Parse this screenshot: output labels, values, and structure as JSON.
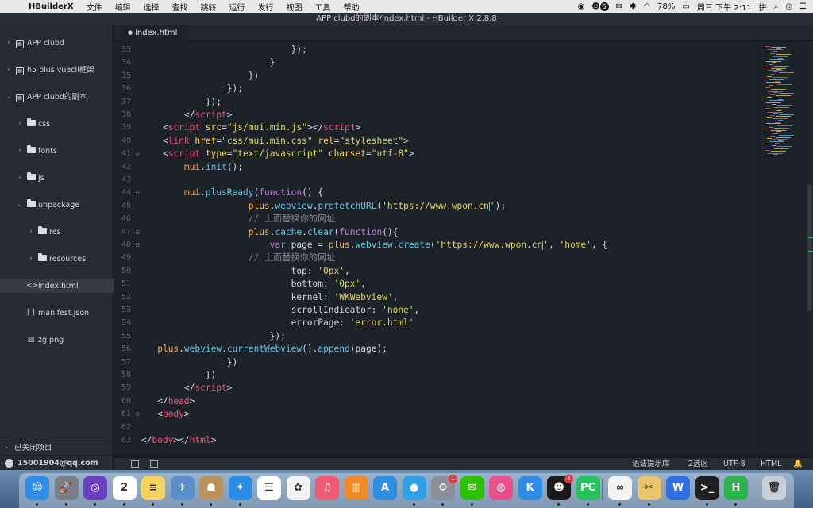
{
  "menubar": {
    "apple_glyph": "",
    "app_name": "HBuilderX",
    "items": [
      "文件",
      "编辑",
      "选择",
      "查找",
      "跳转",
      "运行",
      "发行",
      "视图",
      "工具",
      "帮助"
    ],
    "tray": {
      "notification_count": "5",
      "battery": "78%",
      "datetime": "周三 下午 2:11",
      "input_method": "拼"
    }
  },
  "window": {
    "title": "APP clubd的副本/index.html - HBuilder X 2.8.8"
  },
  "sidebar": {
    "tree": [
      {
        "label": "APP clubd",
        "level": 0,
        "type": "project",
        "expanded": false
      },
      {
        "label": "h5 plus vuecli框架",
        "level": 0,
        "type": "project",
        "expanded": false
      },
      {
        "label": "APP clubd的副本",
        "level": 0,
        "type": "project",
        "expanded": true
      },
      {
        "label": "css",
        "level": 1,
        "type": "folder",
        "expanded": false
      },
      {
        "label": "fonts",
        "level": 1,
        "type": "folder",
        "expanded": false
      },
      {
        "label": "js",
        "level": 1,
        "type": "folder",
        "expanded": false
      },
      {
        "label": "unpackage",
        "level": 1,
        "type": "folder",
        "expanded": true
      },
      {
        "label": "res",
        "level": 2,
        "type": "folder",
        "expanded": false
      },
      {
        "label": "resources",
        "level": 2,
        "type": "folder",
        "expanded": false
      },
      {
        "label": "index.html",
        "level": 1,
        "type": "html",
        "selected": true
      },
      {
        "label": "manifest.json",
        "level": 1,
        "type": "json"
      },
      {
        "label": "zg.png",
        "level": 1,
        "type": "image"
      }
    ],
    "closed_projects": "已关闭项目",
    "account": "15001904@qq.com"
  },
  "tabs": [
    {
      "label": "index.html",
      "active": true
    }
  ],
  "editor": {
    "lines": [
      {
        "n": "33",
        "fold": "",
        "tokens": [
          [
            "p",
            "                            });"
          ]
        ]
      },
      {
        "n": "34",
        "fold": "",
        "tokens": [
          [
            "p",
            "                        }"
          ]
        ]
      },
      {
        "n": "35",
        "fold": "",
        "tokens": [
          [
            "p",
            "                    })"
          ]
        ]
      },
      {
        "n": "36",
        "fold": "",
        "tokens": [
          [
            "p",
            "                });"
          ]
        ]
      },
      {
        "n": "37",
        "fold": "",
        "tokens": [
          [
            "p",
            "            });"
          ]
        ]
      },
      {
        "n": "38",
        "fold": "",
        "tokens": [
          [
            "p",
            "        </"
          ],
          [
            "tag",
            "script"
          ],
          [
            "p",
            ">"
          ]
        ]
      },
      {
        "n": "39",
        "fold": "",
        "tokens": [
          [
            "p",
            "    <"
          ],
          [
            "tag",
            "script"
          ],
          [
            "p",
            " "
          ],
          [
            "attr",
            "src"
          ],
          [
            "p",
            "="
          ],
          [
            "str",
            "\"js/mui.min.js\""
          ],
          [
            "p",
            "></"
          ],
          [
            "tag",
            "script"
          ],
          [
            "p",
            ">"
          ]
        ]
      },
      {
        "n": "40",
        "fold": "",
        "tokens": [
          [
            "p",
            "    <"
          ],
          [
            "tag",
            "link"
          ],
          [
            "p",
            " "
          ],
          [
            "attr",
            "href"
          ],
          [
            "p",
            "="
          ],
          [
            "str",
            "\"css/mui.min.css\""
          ],
          [
            "p",
            " "
          ],
          [
            "attr",
            "rel"
          ],
          [
            "p",
            "="
          ],
          [
            "str",
            "\"stylesheet\""
          ],
          [
            "p",
            ">"
          ]
        ]
      },
      {
        "n": "41",
        "fold": "⊟",
        "tokens": [
          [
            "p",
            "    <"
          ],
          [
            "tag",
            "script"
          ],
          [
            "p",
            " "
          ],
          [
            "attr",
            "type"
          ],
          [
            "p",
            "="
          ],
          [
            "str",
            "\"text/javascript\""
          ],
          [
            "p",
            " "
          ],
          [
            "attr",
            "charset"
          ],
          [
            "p",
            "="
          ],
          [
            "str",
            "\"utf-8\""
          ],
          [
            "p",
            ">"
          ]
        ]
      },
      {
        "n": "42",
        "fold": "",
        "tokens": [
          [
            "p",
            "        "
          ],
          [
            "obj",
            "mui"
          ],
          [
            "p",
            "."
          ],
          [
            "fn",
            "init"
          ],
          [
            "p",
            "();"
          ]
        ]
      },
      {
        "n": "43",
        "fold": "",
        "tokens": [
          [
            "p",
            ""
          ]
        ]
      },
      {
        "n": "44",
        "fold": "⊟",
        "tokens": [
          [
            "p",
            "        "
          ],
          [
            "obj",
            "mui"
          ],
          [
            "p",
            "."
          ],
          [
            "fn",
            "plusReady"
          ],
          [
            "p",
            "("
          ],
          [
            "kw",
            "function"
          ],
          [
            "p",
            "() {"
          ]
        ]
      },
      {
        "n": "45",
        "fold": "",
        "tokens": [
          [
            "p",
            "                    "
          ],
          [
            "obj",
            "plus"
          ],
          [
            "p",
            "."
          ],
          [
            "fn",
            "webview"
          ],
          [
            "p",
            "."
          ],
          [
            "fn",
            "prefetchURL"
          ],
          [
            "p",
            "("
          ],
          [
            "str",
            "'https://www.wpon.cn"
          ],
          [
            "cursor",
            ""
          ],
          [
            "str",
            "'"
          ],
          [
            "p",
            ");"
          ]
        ]
      },
      {
        "n": "46",
        "fold": "",
        "tokens": [
          [
            "p",
            "                    "
          ],
          [
            "cm",
            "// 上面替换你的网址"
          ]
        ]
      },
      {
        "n": "47",
        "fold": "⊟",
        "tokens": [
          [
            "p",
            "                    "
          ],
          [
            "obj",
            "plus"
          ],
          [
            "p",
            "."
          ],
          [
            "fn",
            "cache"
          ],
          [
            "p",
            "."
          ],
          [
            "fn",
            "clear"
          ],
          [
            "p",
            "("
          ],
          [
            "kw",
            "function"
          ],
          [
            "p",
            "(){"
          ]
        ]
      },
      {
        "n": "48",
        "fold": "⊟",
        "tokens": [
          [
            "p",
            "                        "
          ],
          [
            "kw",
            "var"
          ],
          [
            "p",
            " page = "
          ],
          [
            "obj",
            "plus"
          ],
          [
            "p",
            "."
          ],
          [
            "fn",
            "webview"
          ],
          [
            "p",
            "."
          ],
          [
            "fn",
            "create"
          ],
          [
            "p",
            "("
          ],
          [
            "str",
            "'https://www.wpon.cn"
          ],
          [
            "cursor",
            ""
          ],
          [
            "str",
            "'"
          ],
          [
            "p",
            ", "
          ],
          [
            "str",
            "'home'"
          ],
          [
            "p",
            ", {"
          ]
        ]
      },
      {
        "n": "49",
        "fold": "",
        "tokens": [
          [
            "p",
            "                    "
          ],
          [
            "cm",
            "// 上面替换你的网址"
          ]
        ]
      },
      {
        "n": "50",
        "fold": "",
        "tokens": [
          [
            "p",
            "                            top: "
          ],
          [
            "str",
            "'0px'"
          ],
          [
            "p",
            ","
          ]
        ]
      },
      {
        "n": "51",
        "fold": "",
        "tokens": [
          [
            "p",
            "                            bottom: "
          ],
          [
            "str",
            "'0px'"
          ],
          [
            "p",
            ","
          ]
        ]
      },
      {
        "n": "52",
        "fold": "",
        "tokens": [
          [
            "p",
            "                            kernel: "
          ],
          [
            "str",
            "'WKWebview'"
          ],
          [
            "p",
            ","
          ]
        ]
      },
      {
        "n": "53",
        "fold": "",
        "tokens": [
          [
            "p",
            "                            scrollIndicator: "
          ],
          [
            "str",
            "'none'"
          ],
          [
            "p",
            ","
          ]
        ]
      },
      {
        "n": "54",
        "fold": "",
        "tokens": [
          [
            "p",
            "                            errorPage: "
          ],
          [
            "str",
            "'error.html'"
          ]
        ]
      },
      {
        "n": "55",
        "fold": "",
        "tokens": [
          [
            "p",
            "                        });"
          ]
        ]
      },
      {
        "n": "56",
        "fold": "",
        "tokens": [
          [
            "p",
            "   "
          ],
          [
            "obj",
            "plus"
          ],
          [
            "p",
            "."
          ],
          [
            "fn",
            "webview"
          ],
          [
            "p",
            "."
          ],
          [
            "fn",
            "currentWebview"
          ],
          [
            "p",
            "()."
          ],
          [
            "fn",
            "append"
          ],
          [
            "p",
            "(page);"
          ]
        ]
      },
      {
        "n": "57",
        "fold": "",
        "tokens": [
          [
            "p",
            "                })"
          ]
        ]
      },
      {
        "n": "58",
        "fold": "",
        "tokens": [
          [
            "p",
            "            })"
          ]
        ]
      },
      {
        "n": "59",
        "fold": "",
        "tokens": [
          [
            "p",
            "        </"
          ],
          [
            "tag",
            "script"
          ],
          [
            "p",
            ">"
          ]
        ]
      },
      {
        "n": "60",
        "fold": "",
        "tokens": [
          [
            "p",
            "   </"
          ],
          [
            "tag",
            "head"
          ],
          [
            "p",
            ">"
          ]
        ]
      },
      {
        "n": "61",
        "fold": "⊟",
        "tokens": [
          [
            "p",
            "   <"
          ],
          [
            "tag",
            "body"
          ],
          [
            "p",
            ">"
          ]
        ]
      },
      {
        "n": "62",
        "fold": "",
        "tokens": [
          [
            "p",
            ""
          ]
        ]
      },
      {
        "n": "63",
        "fold": "",
        "tokens": [
          [
            "p",
            "</"
          ],
          [
            "tag",
            "body"
          ],
          [
            "p",
            "></"
          ],
          [
            "tag",
            "html"
          ],
          [
            "p",
            ">"
          ]
        ]
      }
    ]
  },
  "statusbar": {
    "syntax_hint_label": "语法提示库",
    "selection": "2选区",
    "encoding": "UTF-8",
    "language": "HTML"
  },
  "dock": {
    "apps": [
      {
        "name": "finder",
        "glyph": "☺",
        "color": "#2f8de4"
      },
      {
        "name": "launchpad",
        "glyph": "🚀",
        "color": "#7a7f88"
      },
      {
        "name": "siri",
        "glyph": "◎",
        "color": "#6a3fc0"
      },
      {
        "name": "calendar",
        "glyph": "2",
        "color": "#ffffff"
      },
      {
        "name": "notes",
        "glyph": "≡",
        "color": "#f4d35e"
      },
      {
        "name": "preview",
        "glyph": "✈",
        "color": "#5b8fc9"
      },
      {
        "name": "contacts",
        "glyph": "☗",
        "color": "#b9915a"
      },
      {
        "name": "safari",
        "glyph": "✦",
        "color": "#2a8ce5"
      },
      {
        "name": "reminders",
        "glyph": "☰",
        "color": "#ffffff"
      },
      {
        "name": "photos",
        "glyph": "✿",
        "color": "#f4f4f4"
      },
      {
        "name": "music",
        "glyph": "♫",
        "color": "#f05a72"
      },
      {
        "name": "books",
        "glyph": "▥",
        "color": "#f08a24"
      },
      {
        "name": "app-store",
        "glyph": "A",
        "color": "#2f8de4"
      },
      {
        "name": "qq-browser",
        "glyph": "●",
        "color": "#2fa0e8"
      },
      {
        "name": "system-preferences",
        "glyph": "⚙",
        "color": "#8a8f98"
      },
      {
        "name": "wechat",
        "glyph": "✉",
        "color": "#2dc100"
      },
      {
        "name": "color-app",
        "glyph": "◍",
        "color": "#e84f8c"
      },
      {
        "name": "keynote-k",
        "glyph": "K",
        "color": "#2f8de4"
      },
      {
        "name": "qq",
        "glyph": "☻",
        "color": "#1b1b1b"
      },
      {
        "name": "pycharm",
        "glyph": "PC",
        "color": "#21c35a"
      },
      {
        "name": "baidu-netdisk",
        "glyph": "∞",
        "color": "#f4f4f4"
      },
      {
        "name": "scissors-tool",
        "glyph": "✂",
        "color": "#e9c46a"
      },
      {
        "name": "wps-office",
        "glyph": "W",
        "color": "#2f6fe0"
      },
      {
        "name": "terminal",
        "glyph": ">_",
        "color": "#1f1f1f"
      },
      {
        "name": "hbuilderx",
        "glyph": "H",
        "color": "#2db34a"
      },
      {
        "name": "trash",
        "glyph": "🗑",
        "color": "#c8ced6"
      }
    ],
    "badges": {
      "system-preferences": "1",
      "qq": "5"
    }
  },
  "colors": {
    "editor_bg": "#1d2128",
    "sidebar_bg": "#262a31",
    "tag": "#f0506e",
    "attr": "#fbd44b",
    "string": "#e0d561",
    "keyword": "#c678dd",
    "comment": "#7d8590",
    "function": "#62c1e8",
    "object": "#f7b04e"
  }
}
